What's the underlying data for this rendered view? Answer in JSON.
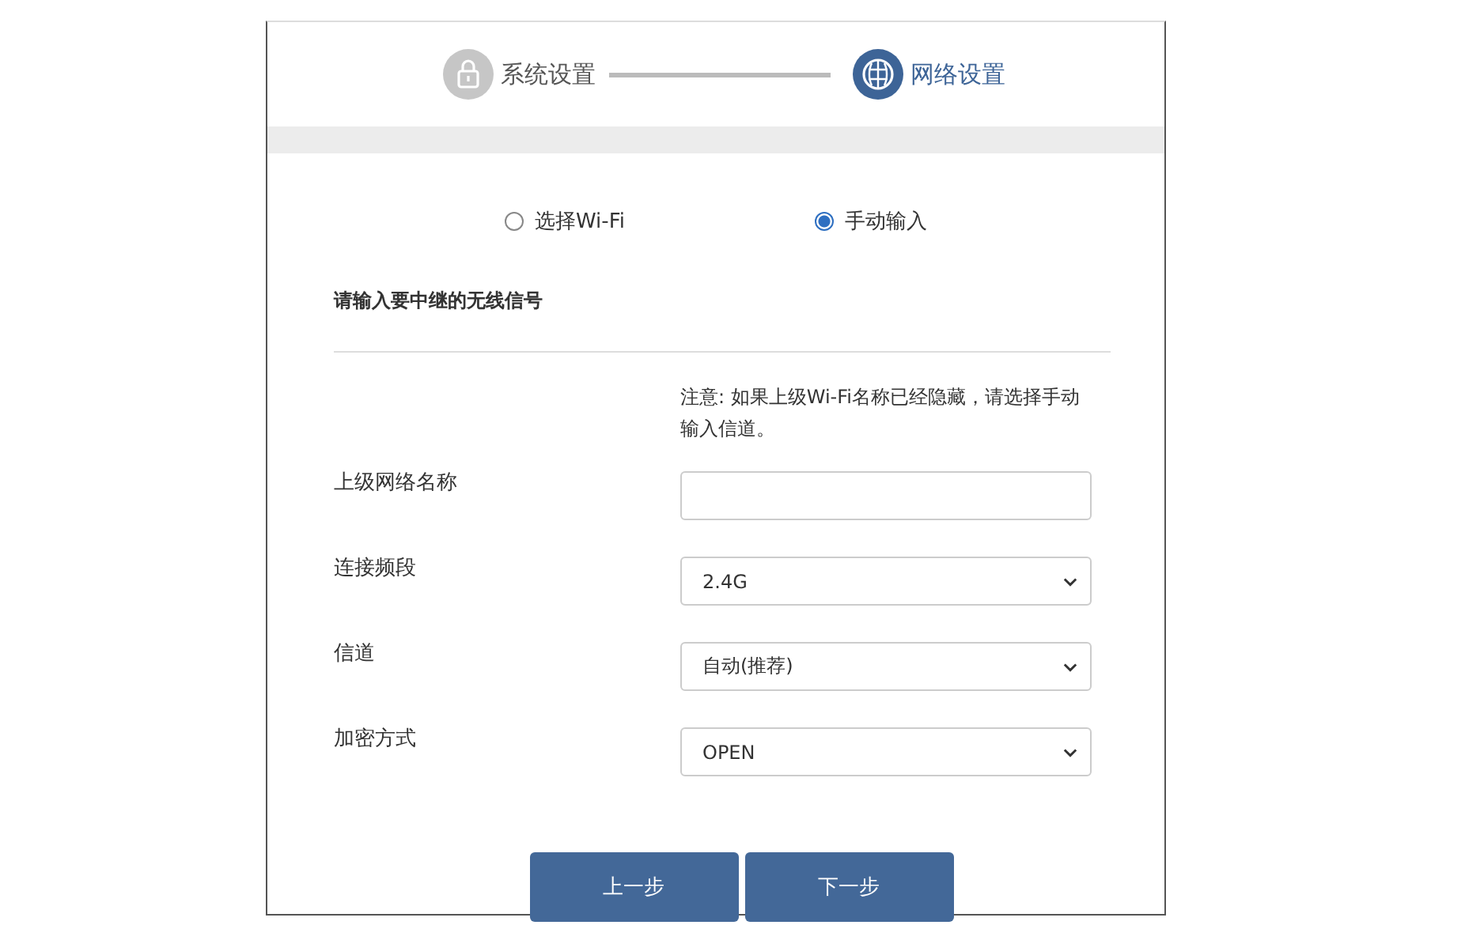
{
  "steps": [
    {
      "label": "系统设置",
      "selected": false
    },
    {
      "label": "网络设置",
      "selected": true
    }
  ],
  "modes": [
    {
      "label": "选择Wi-Fi",
      "selected": false
    },
    {
      "label": "手动输入",
      "selected": true
    }
  ],
  "heading": "请输入要中继的无线信号",
  "note": "注意: 如果上级Wi-Fi名称已经隐藏，请选择手动输入信道。",
  "fields": [
    {
      "kind": "text",
      "label": "上级网络名称"
    },
    {
      "kind": "select",
      "label": "连接频段",
      "value": "2.4G"
    },
    {
      "kind": "select",
      "label": "信道",
      "value": "自动(推荐)"
    },
    {
      "kind": "select",
      "label": "加密方式",
      "value": "OPEN"
    }
  ],
  "buttons": [
    "上一步",
    "下一步"
  ]
}
